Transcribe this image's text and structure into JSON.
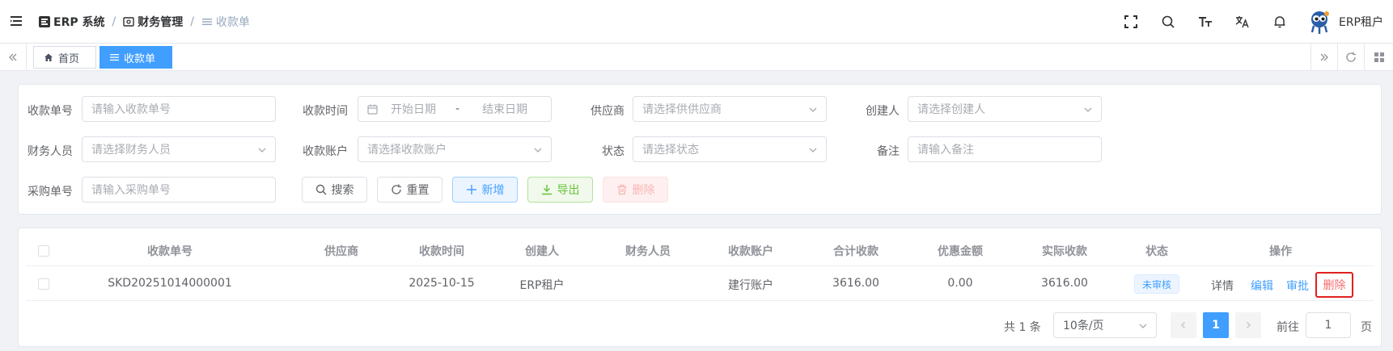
{
  "breadcrumb": {
    "app": "ERP 系统",
    "module": "财务管理",
    "page": "收款单"
  },
  "user": {
    "name": "ERP租户"
  },
  "tags": {
    "home": "首页",
    "current": "收款单"
  },
  "filters": {
    "receipt_no": {
      "label": "收款单号",
      "placeholder": "请输入收款单号"
    },
    "receipt_time": {
      "label": "收款时间",
      "start": "开始日期",
      "separator": "-",
      "end": "结束日期"
    },
    "supplier": {
      "label": "供应商",
      "placeholder": "请选择供供应商"
    },
    "creator": {
      "label": "创建人",
      "placeholder": "请选择创建人"
    },
    "finance_user": {
      "label": "财务人员",
      "placeholder": "请选择财务人员"
    },
    "account": {
      "label": "收款账户",
      "placeholder": "请选择收款账户"
    },
    "status": {
      "label": "状态",
      "placeholder": "请选择状态"
    },
    "remark": {
      "label": "备注",
      "placeholder": "请输入备注"
    },
    "purchase_no": {
      "label": "采购单号",
      "placeholder": "请输入采购单号"
    }
  },
  "actions": {
    "search": "搜索",
    "reset": "重置",
    "add": "新增",
    "export": "导出",
    "delete": "删除"
  },
  "table": {
    "columns": [
      "收款单号",
      "供应商",
      "收款时间",
      "创建人",
      "财务人员",
      "收款账户",
      "合计收款",
      "优惠金额",
      "实际收款",
      "状态",
      "操作"
    ],
    "rows": [
      {
        "no": "SKD20251014000001",
        "supplier": "",
        "time": "2025-10-15",
        "creator": "ERP租户",
        "finance": "",
        "account": "建行账户",
        "total": "3616.00",
        "discount": "0.00",
        "actual": "3616.00",
        "status": "未审核",
        "ops": {
          "detail": "详情",
          "edit": "编辑",
          "approve": "审批",
          "delete": "删除"
        }
      }
    ]
  },
  "pagination": {
    "total": "共 1 条",
    "page_size": "10条/页",
    "current": "1",
    "goto_label": "前往",
    "goto_value": "1",
    "goto_suffix": "页"
  },
  "colors": {
    "primary": "#409eff",
    "danger": "#f56c6c",
    "success": "#67c23a"
  }
}
